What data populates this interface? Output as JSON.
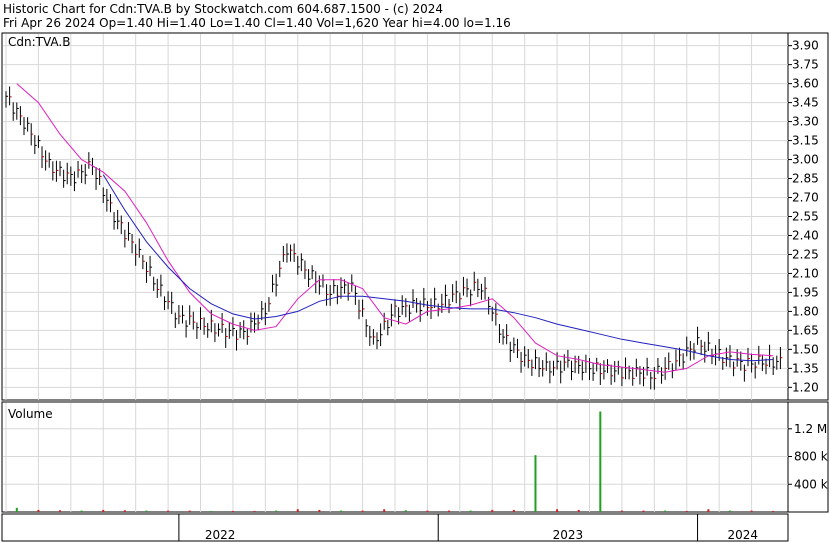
{
  "header": {
    "line1": "Historic Chart for Cdn:TVA.B by Stockwatch.com 604.687.1500 - (c) 2024",
    "line2": "Fri Apr 26 2024  Op=1.40  Hi=1.40  Lo=1.40  Cl=1.40  Vol=1,620  Year hi=4.00  lo=1.16"
  },
  "colors": {
    "grid": "#d8d8d8",
    "price_bar_up": "#000000",
    "price_bar_down": "#cc0000",
    "ma_short": "#e020c0",
    "ma_long": "#2020c0",
    "volume_up": "#20a020",
    "volume_down": "#d02020"
  },
  "chart_data": [
    {
      "type": "line",
      "title": "Cdn:TVA.B",
      "ylim": [
        1.1,
        4.0
      ],
      "y_ticks": [
        "3.90",
        "3.75",
        "3.60",
        "3.45",
        "3.30",
        "3.15",
        "3.00",
        "2.85",
        "2.70",
        "2.55",
        "2.40",
        "2.25",
        "2.10",
        "1.95",
        "1.80",
        "1.65",
        "1.50",
        "1.35",
        "1.20"
      ],
      "x_categories": [
        "2022",
        "2023",
        "2024"
      ],
      "grid": true,
      "series": [
        {
          "kind": "price",
          "x": [
            "2021-05",
            "2021-06",
            "2021-07",
            "2021-08",
            "2021-09",
            "2021-10",
            "2021-11",
            "2021-12",
            "2022-01",
            "2022-02",
            "2022-03",
            "2022-04",
            "2022-05",
            "2022-06",
            "2022-07",
            "2022-08",
            "2022-09",
            "2022-10",
            "2022-11",
            "2022-12",
            "2023-01",
            "2023-02",
            "2023-03",
            "2023-04",
            "2023-05",
            "2023-06",
            "2023-07",
            "2023-08",
            "2023-09",
            "2023-10",
            "2023-11",
            "2023-12",
            "2024-01",
            "2024-02",
            "2024-03",
            "2024-04"
          ],
          "values": [
            3.5,
            3.25,
            2.95,
            2.85,
            2.95,
            2.55,
            2.3,
            2.0,
            1.75,
            1.7,
            1.65,
            1.62,
            1.8,
            2.3,
            2.1,
            1.95,
            2.0,
            1.55,
            1.8,
            1.85,
            1.85,
            1.95,
            2.0,
            1.6,
            1.42,
            1.35,
            1.38,
            1.35,
            1.33,
            1.32,
            1.3,
            1.4,
            1.55,
            1.45,
            1.38,
            1.4
          ]
        },
        {
          "kind": "moving_average_short",
          "x": [
            "2021-05",
            "2021-06",
            "2021-07",
            "2021-08",
            "2021-09",
            "2021-10",
            "2021-11",
            "2021-12",
            "2022-01",
            "2022-02",
            "2022-03",
            "2022-04",
            "2022-05",
            "2022-06",
            "2022-07",
            "2022-08",
            "2022-09",
            "2022-10",
            "2022-11",
            "2022-12",
            "2023-01",
            "2023-02",
            "2023-03",
            "2023-04",
            "2023-05",
            "2023-06",
            "2023-07",
            "2023-08",
            "2023-09",
            "2023-10",
            "2023-11",
            "2023-12",
            "2024-01",
            "2024-02",
            "2024-03",
            "2024-04"
          ],
          "values": [
            3.6,
            3.45,
            3.2,
            3.0,
            2.9,
            2.75,
            2.5,
            2.2,
            1.95,
            1.78,
            1.7,
            1.65,
            1.68,
            1.9,
            2.05,
            2.05,
            1.98,
            1.75,
            1.7,
            1.8,
            1.82,
            1.85,
            1.9,
            1.75,
            1.55,
            1.45,
            1.42,
            1.38,
            1.36,
            1.34,
            1.32,
            1.35,
            1.45,
            1.48,
            1.46,
            1.45
          ]
        },
        {
          "kind": "moving_average_long",
          "x": [
            "2021-09",
            "2021-10",
            "2021-11",
            "2021-12",
            "2022-01",
            "2022-02",
            "2022-03",
            "2022-04",
            "2022-05",
            "2022-06",
            "2022-07",
            "2022-08",
            "2022-09",
            "2022-10",
            "2022-11",
            "2022-12",
            "2023-01",
            "2023-02",
            "2023-03",
            "2023-04",
            "2023-05",
            "2023-06",
            "2023-07",
            "2023-08",
            "2023-09",
            "2023-10",
            "2023-11",
            "2023-12",
            "2024-01",
            "2024-02",
            "2024-03",
            "2024-04"
          ],
          "values": [
            2.88,
            2.6,
            2.35,
            2.15,
            1.98,
            1.86,
            1.78,
            1.74,
            1.76,
            1.8,
            1.88,
            1.92,
            1.92,
            1.9,
            1.88,
            1.85,
            1.83,
            1.82,
            1.82,
            1.79,
            1.75,
            1.7,
            1.66,
            1.62,
            1.58,
            1.55,
            1.52,
            1.49,
            1.45,
            1.42,
            1.41,
            1.42
          ]
        }
      ]
    },
    {
      "type": "bar",
      "title": "Volume",
      "y_ticks": [
        "1.2 M",
        "800 k",
        "400 k"
      ],
      "ylim": [
        0,
        1500000
      ],
      "categories": [
        "2021-05",
        "2021-06",
        "2021-07",
        "2021-08",
        "2021-09",
        "2021-10",
        "2021-11",
        "2021-12",
        "2022-01",
        "2022-02",
        "2022-03",
        "2022-04",
        "2022-05",
        "2022-06",
        "2022-07",
        "2022-08",
        "2022-09",
        "2022-10",
        "2022-11",
        "2022-12",
        "2023-01",
        "2023-02",
        "2023-03",
        "2023-04",
        "2023-05",
        "2023-06",
        "2023-07",
        "2023-08",
        "2023-09",
        "2023-10",
        "2023-11",
        "2023-12",
        "2024-01",
        "2024-02",
        "2024-03",
        "2024-04"
      ],
      "values": [
        60000,
        30000,
        25000,
        20000,
        30000,
        25000,
        20000,
        20000,
        20000,
        15000,
        15000,
        15000,
        20000,
        40000,
        30000,
        20000,
        20000,
        40000,
        25000,
        20000,
        20000,
        20000,
        30000,
        30000,
        820000,
        40000,
        30000,
        1450000,
        20000,
        20000,
        20000,
        15000,
        40000,
        20000,
        20000,
        15000
      ]
    }
  ]
}
